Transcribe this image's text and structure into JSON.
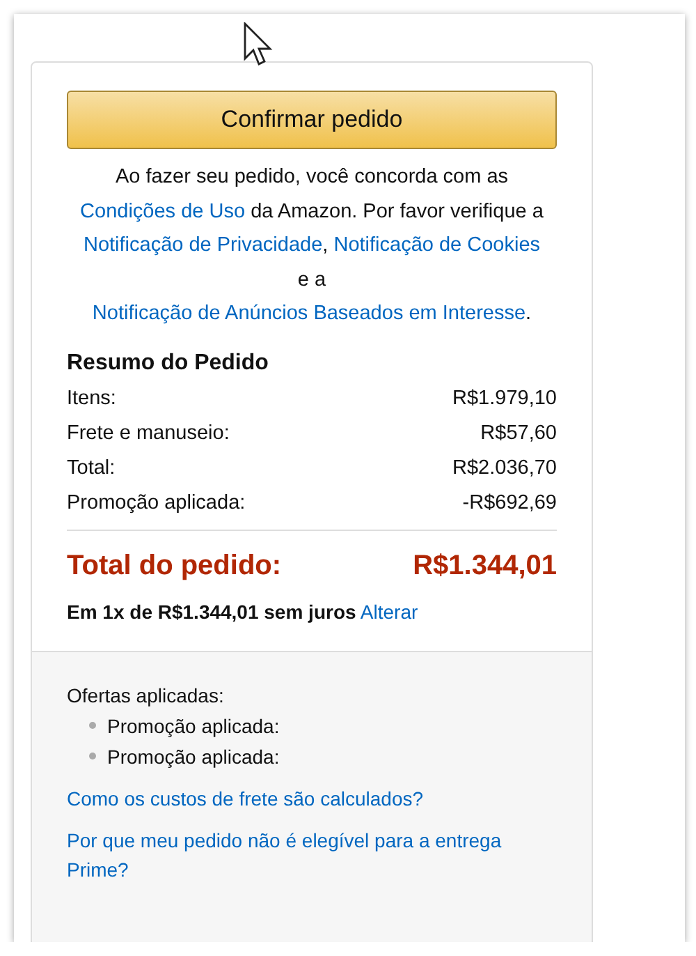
{
  "place_order_button": "Confirmar pedido",
  "agreement": [
    {
      "kind": "text",
      "text": "Ao fazer seu pedido, você concorda com as"
    },
    {
      "kind": "link",
      "text": "Condições de Uso"
    },
    {
      "kind": "text",
      "text": "da Amazon. Por favor verifique a"
    },
    {
      "kind": "link",
      "text": "Notificação de Privacidade"
    },
    {
      "kind": "text",
      "text": ","
    },
    {
      "kind": "link",
      "text": "Notificação de Cookies"
    },
    {
      "kind": "text",
      "text": "e a"
    },
    {
      "kind": "link",
      "text": "Notificação de Anúncios Baseados em Interesse"
    },
    {
      "kind": "text",
      "text": "."
    }
  ],
  "summary": {
    "title": "Resumo do Pedido",
    "rows": [
      {
        "label": "Itens:",
        "value": "R$1.979,10"
      },
      {
        "label": "Frete e manuseio:",
        "value": "R$57,60"
      },
      {
        "label": "Total:",
        "value": "R$2.036,70"
      },
      {
        "label": "Promoção aplicada:",
        "value": "-R$692,69"
      }
    ],
    "order_total": {
      "label": "Total do pedido:",
      "value": "R$1.344,01"
    },
    "installment": {
      "text": "Em 1x de R$1.344,01 sem juros",
      "link": "Alterar"
    }
  },
  "offers": {
    "title": "Ofertas aplicadas:",
    "items": [
      "Promoção aplicada:",
      "Promoção aplicada:"
    ]
  },
  "help_links": [
    "Como os custos de frete são calculados?",
    "Por que meu pedido não é elegível para a entrega Prime?"
  ]
}
